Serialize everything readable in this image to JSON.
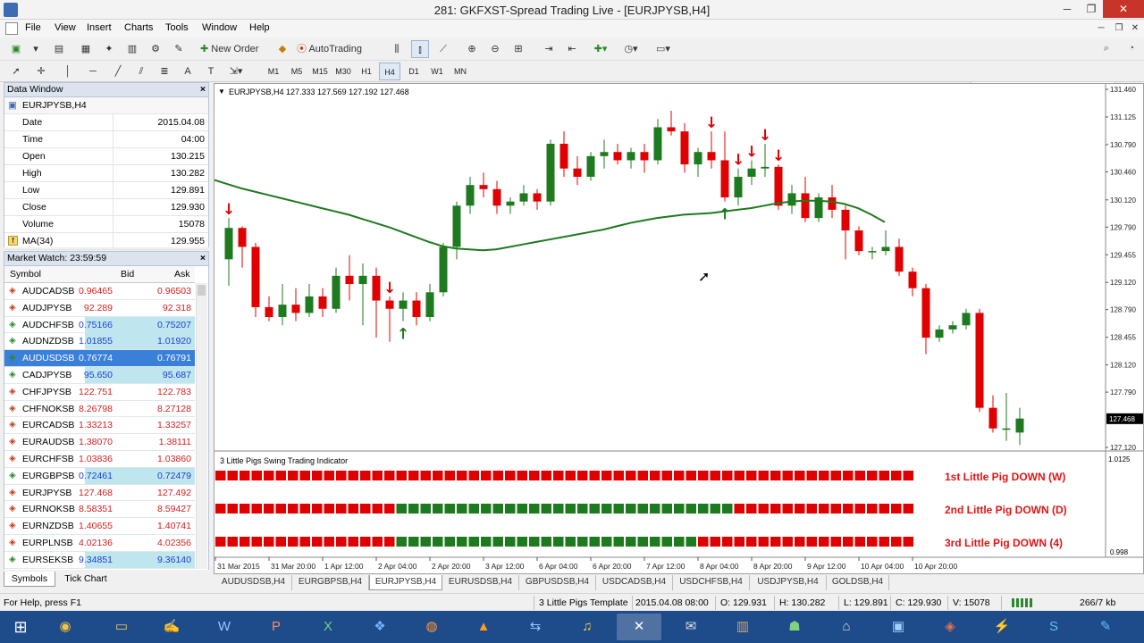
{
  "window": {
    "title": "281: GKFXST-Spread Trading Live - [EURJPYSB,H4]",
    "minimize": "─",
    "maximize": "❐",
    "close": "✕",
    "min2": "─",
    "restore2": "❐",
    "close2": "✕"
  },
  "menu": [
    "File",
    "View",
    "Insert",
    "Charts",
    "Tools",
    "Window",
    "Help"
  ],
  "toolbar": {
    "new_order": "New Order",
    "autotrading": "AutoTrading",
    "search_placeholder": ""
  },
  "timeframes": [
    "M1",
    "M5",
    "M15",
    "M30",
    "H1",
    "H4",
    "D1",
    "W1",
    "MN"
  ],
  "timeframe_selected": "H4",
  "data_window": {
    "title": "Data Window",
    "symbol": "EURJPYSB,H4",
    "rows": [
      {
        "k": "Date",
        "v": "2015.04.08"
      },
      {
        "k": "Time",
        "v": "04:00"
      },
      {
        "k": "Open",
        "v": "130.215"
      },
      {
        "k": "High",
        "v": "130.282"
      },
      {
        "k": "Low",
        "v": "129.891"
      },
      {
        "k": "Close",
        "v": "129.930"
      },
      {
        "k": "Volume",
        "v": "15078"
      },
      {
        "k": "MA(34)",
        "v": "129.955"
      }
    ]
  },
  "market_watch": {
    "title": "Market Watch: 23:59:59",
    "col_symbol": "Symbol",
    "col_bid": "Bid",
    "col_ask": "Ask",
    "rows": [
      {
        "sym": "AUDCADSB",
        "bid": "0.96465",
        "ask": "0.96503",
        "c": "#d42020",
        "pc": false
      },
      {
        "sym": "AUDJPYSB",
        "bid": "92.289",
        "ask": "92.318",
        "c": "#d42020",
        "pc": false
      },
      {
        "sym": "AUDCHFSB",
        "bid": "0.75166",
        "ask": "0.75207",
        "c": "#1a3fd4",
        "pc": true
      },
      {
        "sym": "AUDNZDSB",
        "bid": "1.01855",
        "ask": "1.01920",
        "c": "#1a3fd4",
        "pc": true
      },
      {
        "sym": "AUDUSDSB",
        "bid": "0.76774",
        "ask": "0.76791",
        "c": "#1a3fd4",
        "pc": true,
        "sel": true
      },
      {
        "sym": "CADJPYSB",
        "bid": "95.650",
        "ask": "95.687",
        "c": "#1a3fd4",
        "pc": true
      },
      {
        "sym": "CHFJPYSB",
        "bid": "122.751",
        "ask": "122.783",
        "c": "#d42020",
        "pc": false
      },
      {
        "sym": "CHFNOKSB",
        "bid": "8.26798",
        "ask": "8.27128",
        "c": "#d42020",
        "pc": false
      },
      {
        "sym": "EURCADSB",
        "bid": "1.33213",
        "ask": "1.33257",
        "c": "#d42020",
        "pc": false
      },
      {
        "sym": "EURAUDSB",
        "bid": "1.38070",
        "ask": "1.38111",
        "c": "#d42020",
        "pc": false
      },
      {
        "sym": "EURCHFSB",
        "bid": "1.03836",
        "ask": "1.03860",
        "c": "#d42020",
        "pc": false
      },
      {
        "sym": "EURGBPSB",
        "bid": "0.72461",
        "ask": "0.72479",
        "c": "#1a3fd4",
        "pc": true
      },
      {
        "sym": "EURJPYSB",
        "bid": "127.468",
        "ask": "127.492",
        "c": "#d42020",
        "pc": false
      },
      {
        "sym": "EURNOKSB",
        "bid": "8.58351",
        "ask": "8.59427",
        "c": "#d42020",
        "pc": false
      },
      {
        "sym": "EURNZDSB",
        "bid": "1.40655",
        "ask": "1.40741",
        "c": "#d42020",
        "pc": false
      },
      {
        "sym": "EURPLNSB",
        "bid": "4.02136",
        "ask": "4.02356",
        "c": "#d42020",
        "pc": false
      },
      {
        "sym": "EURSEKSB",
        "bid": "9.34851",
        "ask": "9.36140",
        "c": "#1a3fd4",
        "pc": true
      }
    ],
    "tabs": [
      "Symbols",
      "Tick Chart"
    ]
  },
  "chart": {
    "header": "EURJPYSB,H4  127.333 127.569 127.192 127.468",
    "price_labels": [
      "131.460",
      "131.125",
      "130.790",
      "130.460",
      "130.120",
      "129.790",
      "129.455",
      "129.120",
      "128.790",
      "128.455",
      "128.120",
      "127.790",
      "127.468",
      "127.120"
    ],
    "current_price": "127.468",
    "ma_color": "#1e7a1e",
    "bull_color": "#1e7a1e",
    "bear_color": "#e00000",
    "ma_series": [
      130.36,
      130.31,
      130.26,
      130.22,
      130.18,
      130.14,
      130.1,
      130.06,
      130.02,
      129.98,
      129.94,
      129.89,
      129.84,
      129.79,
      129.73,
      129.67,
      129.61,
      129.56,
      129.53,
      129.52,
      129.51,
      129.52,
      129.55,
      129.58,
      129.61,
      129.64,
      129.67,
      129.7,
      129.73,
      129.76,
      129.8,
      129.84,
      129.87,
      129.9,
      129.92,
      129.94,
      129.95,
      129.96,
      129.98,
      130.0,
      130.02,
      130.05,
      130.08,
      130.1,
      130.11,
      130.11,
      130.1,
      130.07,
      130.02,
      129.94,
      129.85
    ],
    "x_labels": [
      "31 Mar 2015",
      "31 Mar 20:00",
      "1 Apr 12:00",
      "2 Apr 04:00",
      "2 Apr 20:00",
      "3 Apr 12:00",
      "6 Apr 04:00",
      "6 Apr 20:00",
      "7 Apr 12:00",
      "8 Apr 04:00",
      "8 Apr 20:00",
      "9 Apr 12:00",
      "10 Apr 04:00",
      "10 Apr 20:00"
    ],
    "indicator_title": "3 Little Pigs Swing Trading Indicator",
    "indicator_scale": [
      "1.0125",
      "0.998"
    ],
    "pig_labels": [
      "1st Little Pig DOWN (W)",
      "2nd Little Pig DOWN (D)",
      "3rd Little Pig DOWN (4)"
    ],
    "pig_rows": [
      "RRRRRRRRRRRRRRRRRRRRRRRRRRRRRRRRRRRRRRRRRRRRRRRRRRRRRRRRRR",
      "RRRRRRRRRRRRRRRGGGGGGGGGGGGGGGGGGGGGGGGGGGGRRRRRRRRRRRRRRR",
      "RRRRRRRRRRRRRRRGGGGGGGGGGGGGGGGGGGGGGGGGRRRRRRRRRRRRRRRRRR"
    ],
    "candles": [
      {
        "o": 129.4,
        "h": 129.9,
        "l": 129.08,
        "c": 129.78
      },
      {
        "o": 129.78,
        "h": 129.8,
        "l": 129.3,
        "c": 129.55
      },
      {
        "o": 129.55,
        "h": 129.6,
        "l": 128.7,
        "c": 128.82
      },
      {
        "o": 128.82,
        "h": 128.95,
        "l": 128.65,
        "c": 128.7
      },
      {
        "o": 128.7,
        "h": 129.1,
        "l": 128.6,
        "c": 128.85
      },
      {
        "o": 128.85,
        "h": 129.05,
        "l": 128.65,
        "c": 128.75
      },
      {
        "o": 128.75,
        "h": 129.1,
        "l": 128.7,
        "c": 128.95
      },
      {
        "o": 128.95,
        "h": 129.05,
        "l": 128.7,
        "c": 128.8
      },
      {
        "o": 128.8,
        "h": 129.3,
        "l": 128.75,
        "c": 129.2
      },
      {
        "o": 129.2,
        "h": 129.45,
        "l": 128.9,
        "c": 129.1
      },
      {
        "o": 129.1,
        "h": 129.35,
        "l": 128.6,
        "c": 129.2
      },
      {
        "o": 129.2,
        "h": 129.3,
        "l": 128.45,
        "c": 128.9
      },
      {
        "o": 128.9,
        "h": 128.95,
        "l": 128.4,
        "c": 128.8
      },
      {
        "o": 128.8,
        "h": 129.0,
        "l": 128.65,
        "c": 128.9
      },
      {
        "o": 128.9,
        "h": 129.0,
        "l": 128.6,
        "c": 128.7
      },
      {
        "o": 128.7,
        "h": 129.1,
        "l": 128.65,
        "c": 129.0
      },
      {
        "o": 129.0,
        "h": 129.6,
        "l": 128.95,
        "c": 129.55
      },
      {
        "o": 129.55,
        "h": 130.1,
        "l": 129.4,
        "c": 130.05
      },
      {
        "o": 130.05,
        "h": 130.4,
        "l": 129.95,
        "c": 130.3
      },
      {
        "o": 130.3,
        "h": 130.45,
        "l": 130.15,
        "c": 130.25
      },
      {
        "o": 130.25,
        "h": 130.35,
        "l": 129.95,
        "c": 130.05
      },
      {
        "o": 130.05,
        "h": 130.15,
        "l": 129.95,
        "c": 130.1
      },
      {
        "o": 130.1,
        "h": 130.3,
        "l": 130.05,
        "c": 130.2
      },
      {
        "o": 130.2,
        "h": 130.25,
        "l": 130.0,
        "c": 130.1
      },
      {
        "o": 130.1,
        "h": 130.85,
        "l": 130.05,
        "c": 130.8
      },
      {
        "o": 130.8,
        "h": 130.95,
        "l": 130.4,
        "c": 130.5
      },
      {
        "o": 130.5,
        "h": 130.65,
        "l": 130.3,
        "c": 130.4
      },
      {
        "o": 130.4,
        "h": 130.7,
        "l": 130.35,
        "c": 130.65
      },
      {
        "o": 130.65,
        "h": 130.85,
        "l": 130.5,
        "c": 130.7
      },
      {
        "o": 130.7,
        "h": 130.8,
        "l": 130.55,
        "c": 130.6
      },
      {
        "o": 130.6,
        "h": 130.75,
        "l": 130.5,
        "c": 130.7
      },
      {
        "o": 130.7,
        "h": 130.8,
        "l": 130.45,
        "c": 130.6
      },
      {
        "o": 130.6,
        "h": 131.1,
        "l": 130.55,
        "c": 131.0
      },
      {
        "o": 131.0,
        "h": 131.2,
        "l": 130.9,
        "c": 130.95
      },
      {
        "o": 130.95,
        "h": 131.05,
        "l": 130.45,
        "c": 130.55
      },
      {
        "o": 130.55,
        "h": 130.75,
        "l": 130.4,
        "c": 130.7
      },
      {
        "o": 130.7,
        "h": 130.95,
        "l": 130.5,
        "c": 130.6
      },
      {
        "o": 130.6,
        "h": 130.95,
        "l": 130.1,
        "c": 130.15
      },
      {
        "o": 130.15,
        "h": 130.5,
        "l": 130.05,
        "c": 130.4
      },
      {
        "o": 130.4,
        "h": 130.6,
        "l": 130.3,
        "c": 130.5
      },
      {
        "o": 130.5,
        "h": 130.8,
        "l": 130.4,
        "c": 130.52
      },
      {
        "o": 130.52,
        "h": 130.55,
        "l": 130.0,
        "c": 130.05
      },
      {
        "o": 130.05,
        "h": 130.3,
        "l": 129.95,
        "c": 130.2
      },
      {
        "o": 130.2,
        "h": 130.4,
        "l": 129.85,
        "c": 129.9
      },
      {
        "o": 129.9,
        "h": 130.2,
        "l": 129.85,
        "c": 130.15
      },
      {
        "o": 130.15,
        "h": 130.3,
        "l": 129.9,
        "c": 130.0
      },
      {
        "o": 130.0,
        "h": 130.05,
        "l": 129.4,
        "c": 129.75
      },
      {
        "o": 129.75,
        "h": 129.8,
        "l": 129.45,
        "c": 129.5
      },
      {
        "o": 129.5,
        "h": 129.55,
        "l": 129.4,
        "c": 129.5
      },
      {
        "o": 129.5,
        "h": 129.75,
        "l": 129.45,
        "c": 129.55
      },
      {
        "o": 129.55,
        "h": 129.65,
        "l": 129.2,
        "c": 129.25
      },
      {
        "o": 129.25,
        "h": 129.3,
        "l": 128.95,
        "c": 129.05
      },
      {
        "o": 129.05,
        "h": 129.1,
        "l": 128.25,
        "c": 128.45
      },
      {
        "o": 128.45,
        "h": 128.6,
        "l": 128.4,
        "c": 128.55
      },
      {
        "o": 128.55,
        "h": 128.65,
        "l": 128.5,
        "c": 128.6
      },
      {
        "o": 128.6,
        "h": 128.8,
        "l": 128.55,
        "c": 128.75
      },
      {
        "o": 128.75,
        "h": 128.8,
        "l": 127.55,
        "c": 127.6
      },
      {
        "o": 127.6,
        "h": 127.75,
        "l": 127.3,
        "c": 127.35
      },
      {
        "o": 127.35,
        "h": 127.78,
        "l": 127.2,
        "c": 127.35
      },
      {
        "o": 127.3,
        "h": 127.6,
        "l": 127.15,
        "c": 127.47
      }
    ],
    "down_arrows": [
      0,
      12,
      36,
      38,
      39,
      40,
      41
    ],
    "up_arrows": [
      13,
      37
    ]
  },
  "chart_tabs": [
    "AUDUSDSB,H4",
    "EURGBPSB,H4",
    "EURJPYSB,H4",
    "EURUSDSB,H4",
    "GBPUSDSB,H4",
    "USDCADSB,H4",
    "USDCHFSB,H4",
    "USDJPYSB,H4",
    "GOLDSB,H4"
  ],
  "chart_tab_active": "EURJPYSB,H4",
  "status": {
    "help": "For Help, press F1",
    "template": "3 Little Pigs Template",
    "datetime": "2015.04.08 08:00",
    "open": "O: 129.931",
    "high": "H: 130.282",
    "low": "L: 129.891",
    "close": "C: 129.930",
    "volume": "V: 15078",
    "traffic": "266/7 kb"
  },
  "taskbar_icons": [
    "windows-icon",
    "chrome-icon",
    "file-explorer-icon",
    "cursor-tool-icon",
    "word-icon",
    "powerpoint-icon",
    "excel-icon",
    "dropbox-icon",
    "firefox-icon",
    "vlc-icon",
    "teamviewer-icon",
    "headphones-icon",
    "metatrader-icon",
    "kindle-icon",
    "books-icon",
    "evernote-icon",
    "skype-folder-icon",
    "remote-desktop-icon",
    "pcloud-icon",
    "trading-app-icon",
    "pen-tool-icon",
    "skype-icon"
  ]
}
